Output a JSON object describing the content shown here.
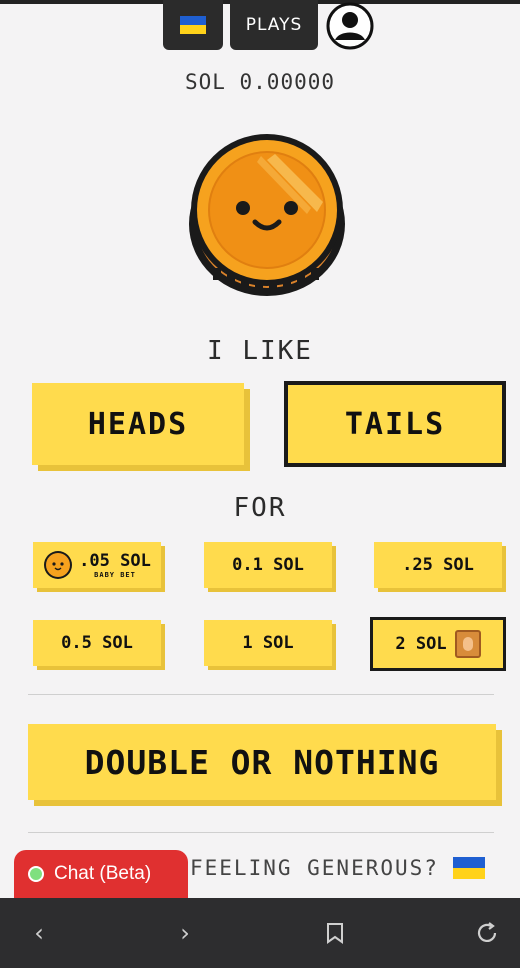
{
  "header": {
    "plays_label": "PLAYS",
    "flag_icon": "ukraine-flag-icon",
    "profile_icon": "user-profile-icon"
  },
  "balance": "SOL 0.00000",
  "coin_icon": "smiling-coin-icon",
  "choice": {
    "prompt": "I LIKE",
    "heads_label": "HEADS",
    "tails_label": "TAILS",
    "selected": "TAILS"
  },
  "bet": {
    "prompt": "FOR",
    "options": [
      {
        "label": ".05 SOL",
        "sub": "BABY BET"
      },
      {
        "label": "0.1 SOL"
      },
      {
        "label": ".25 SOL"
      },
      {
        "label": "0.5 SOL"
      },
      {
        "label": "1 SOL"
      },
      {
        "label": "2 SOL"
      }
    ],
    "selected": "2 SOL"
  },
  "action": {
    "double_label": "DOUBLE OR NOTHING"
  },
  "footer": {
    "generous_label": "FEELING GENEROUS?",
    "chat_label": "Chat (Beta)"
  },
  "colors": {
    "accent_yellow": "#ffdb4d",
    "dark": "#2b2b2b",
    "chat_red": "#e03030"
  }
}
